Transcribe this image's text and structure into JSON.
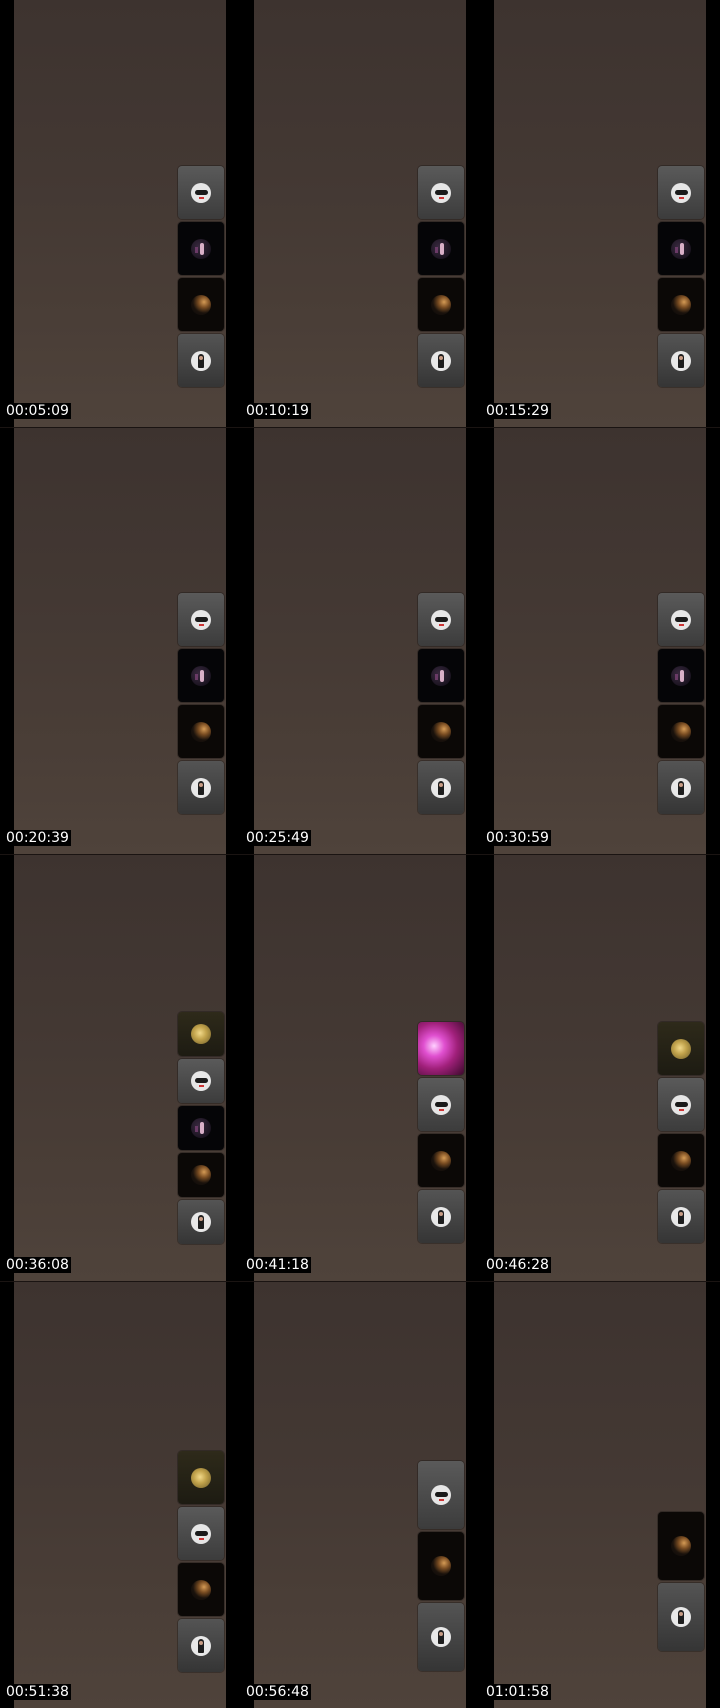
{
  "sheet": {
    "frames": [
      {
        "timestamp": "00:05:09",
        "tiles": [
          "ghost",
          "dancer",
          "moon",
          "woman"
        ]
      },
      {
        "timestamp": "00:10:19",
        "tiles": [
          "ghost",
          "dancer",
          "moon",
          "woman"
        ]
      },
      {
        "timestamp": "00:15:29",
        "tiles": [
          "ghost",
          "dancer",
          "moon",
          "woman"
        ]
      },
      {
        "timestamp": "00:20:39",
        "tiles": [
          "ghost",
          "dancer",
          "moon",
          "woman"
        ]
      },
      {
        "timestamp": "00:25:49",
        "tiles": [
          "ghost",
          "dancer",
          "moon",
          "woman"
        ]
      },
      {
        "timestamp": "00:30:59",
        "tiles": [
          "ghost",
          "dancer",
          "moon",
          "woman"
        ]
      },
      {
        "timestamp": "00:36:08",
        "tiles": [
          "gold",
          "ghost",
          "dancer",
          "moon",
          "woman"
        ]
      },
      {
        "timestamp": "00:41:18",
        "tiles": [
          "pink",
          "ghost",
          "moon",
          "woman"
        ]
      },
      {
        "timestamp": "00:46:28",
        "tiles": [
          "gold",
          "ghost",
          "moon",
          "woman"
        ]
      },
      {
        "timestamp": "00:51:38",
        "tiles": [
          "gold",
          "ghost",
          "moon",
          "woman"
        ]
      },
      {
        "timestamp": "00:56:48",
        "tiles": [
          "ghost",
          "moon",
          "woman"
        ]
      },
      {
        "timestamp": "01:01:58",
        "tiles": [
          "moon",
          "woman"
        ]
      }
    ]
  },
  "icons": {
    "ghost": "ghost-avatar-icon",
    "dancer": "dancer-avatar-icon",
    "moon": "moon-avatar-icon",
    "woman": "woman-avatar-icon",
    "gold": "gold-disc-avatar-icon",
    "pink": "pink-lights-thumbnail-icon"
  }
}
